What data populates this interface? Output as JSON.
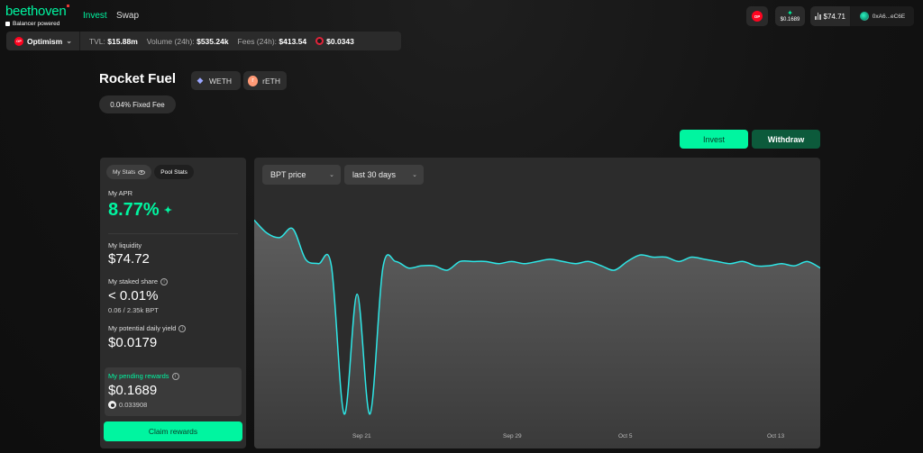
{
  "nav": {
    "logo_text": "beethoven",
    "logo_sub": "Balancer powered",
    "links": [
      "Invest",
      "Swap"
    ],
    "network_badge": "OP",
    "pending_reward": "$0.1689",
    "portfolio_value": "$74.71",
    "wallet_address": "0xA6...eC6E"
  },
  "statsbar": {
    "network": "Optimism",
    "tvl_label": "TVL:",
    "tvl_value": "$15.88m",
    "volume_label": "Volume (24h):",
    "volume_value": "$535.24k",
    "fees_label": "Fees (24h):",
    "fees_value": "$413.54",
    "beets_price": "$0.0343"
  },
  "pool": {
    "title": "Rocket Fuel",
    "tokens": [
      "WETH",
      "rETH"
    ],
    "fee_label": "0.04% Fixed Fee"
  },
  "actions": {
    "invest_label": "Invest",
    "withdraw_label": "Withdraw"
  },
  "stats_card": {
    "tab_my_stats": "My Stats",
    "tab_pool_stats": "Pool Stats",
    "apr_label": "My APR",
    "apr_value": "8.77%",
    "liquidity_label": "My liquidity",
    "liquidity_value": "$74.72",
    "staked_label": "My staked share",
    "staked_value": "< 0.01%",
    "staked_detail": "0.06 / 2.35k BPT",
    "yield_label": "My potential daily yield",
    "yield_value": "$0.0179",
    "pending_label": "My pending rewards",
    "pending_value": "$0.1689",
    "pending_tokens": "0.033908",
    "claim_label": "Claim rewards"
  },
  "chart_controls": {
    "metric": "BPT price",
    "range": "last 30 days"
  },
  "colors": {
    "accent": "#00f5a0",
    "line": "#2ee6e6",
    "op_red": "#ff0420",
    "withdraw_bg": "#0c5a3b"
  },
  "chart_data": {
    "type": "area",
    "title": "",
    "xlabel": "",
    "ylabel": "",
    "x_tick_labels": [
      "Sep 21",
      "Sep 29",
      "Oct 5",
      "Oct 13"
    ],
    "x": [
      0,
      1,
      2,
      3,
      4,
      5,
      6,
      7,
      8,
      9,
      10,
      11,
      12,
      13,
      14,
      15,
      16,
      17,
      18,
      19,
      20,
      21,
      22,
      23,
      24,
      25,
      26,
      27,
      28,
      29,
      30,
      31,
      32,
      33,
      34,
      35,
      36,
      37,
      38,
      39,
      40,
      41,
      42,
      43,
      44
    ],
    "values": [
      0.92,
      0.86,
      0.84,
      0.88,
      0.74,
      0.72,
      0.71,
      0.03,
      0.58,
      0.03,
      0.7,
      0.73,
      0.7,
      0.71,
      0.71,
      0.69,
      0.73,
      0.73,
      0.73,
      0.72,
      0.73,
      0.72,
      0.73,
      0.74,
      0.73,
      0.72,
      0.73,
      0.71,
      0.69,
      0.73,
      0.76,
      0.75,
      0.75,
      0.73,
      0.75,
      0.74,
      0.73,
      0.72,
      0.73,
      0.71,
      0.71,
      0.72,
      0.71,
      0.73,
      0.7
    ],
    "grid": false,
    "legend": "none"
  }
}
